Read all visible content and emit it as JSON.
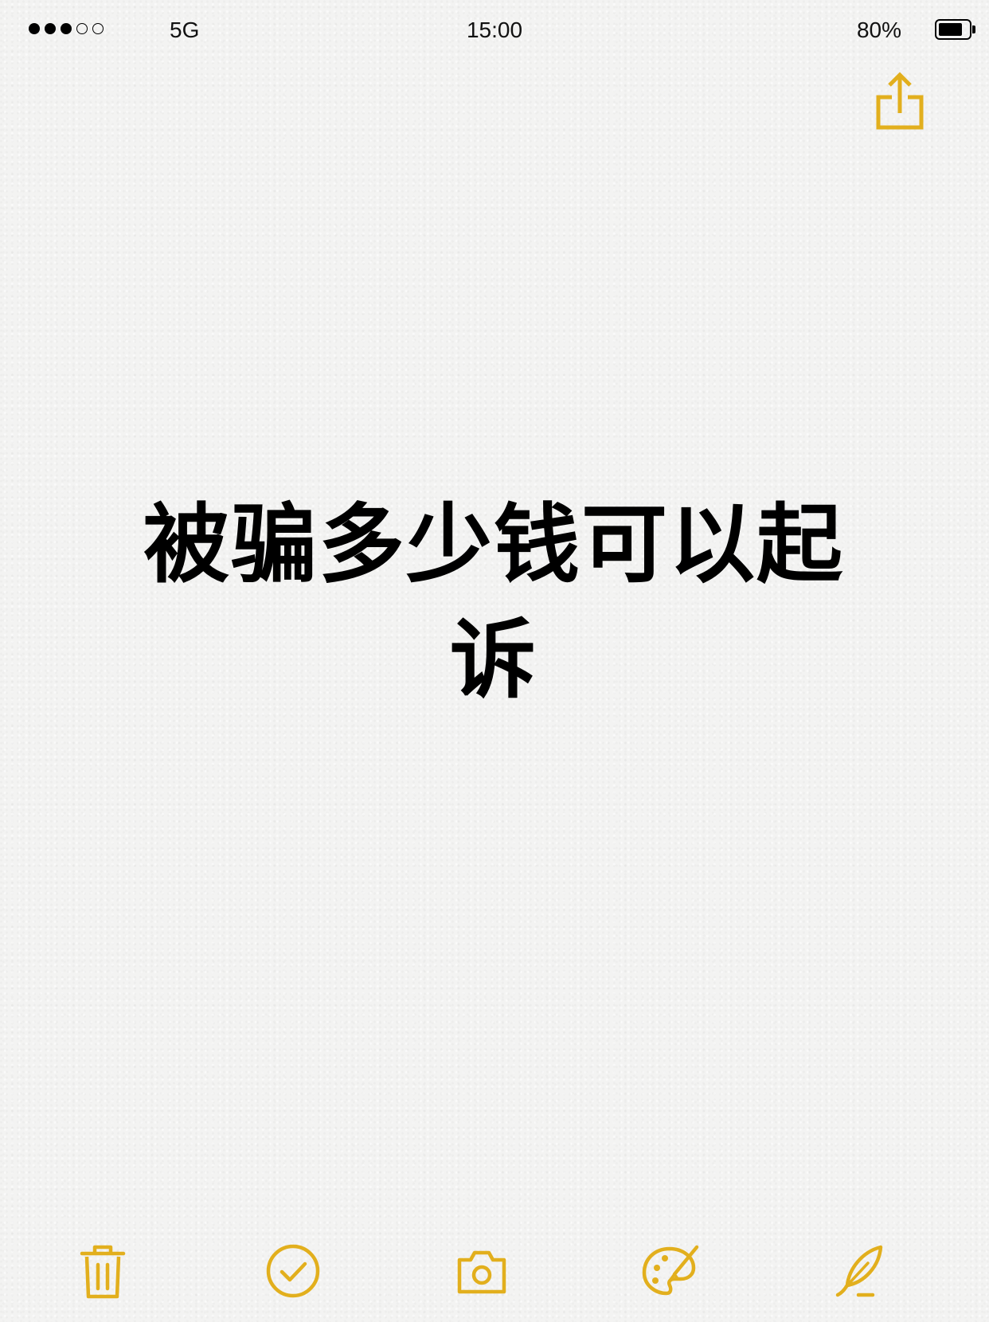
{
  "colors": {
    "accent": "#e2af1d",
    "text": "#000000",
    "background": "#f3f3f2"
  },
  "status_bar": {
    "signal_bars_filled": 3,
    "signal_bars_total": 5,
    "carrier": "5G",
    "time": "15:00",
    "battery_percent_label": "80%",
    "battery_level": 0.8
  },
  "toolbar_top": {
    "share_icon": "share-icon"
  },
  "note": {
    "title": "被骗多少钱可以起诉"
  },
  "toolbar_bottom": {
    "items": [
      {
        "icon": "trash-icon"
      },
      {
        "icon": "checkmark-circle-icon"
      },
      {
        "icon": "camera-icon"
      },
      {
        "icon": "palette-icon"
      },
      {
        "icon": "pen-icon"
      }
    ]
  }
}
